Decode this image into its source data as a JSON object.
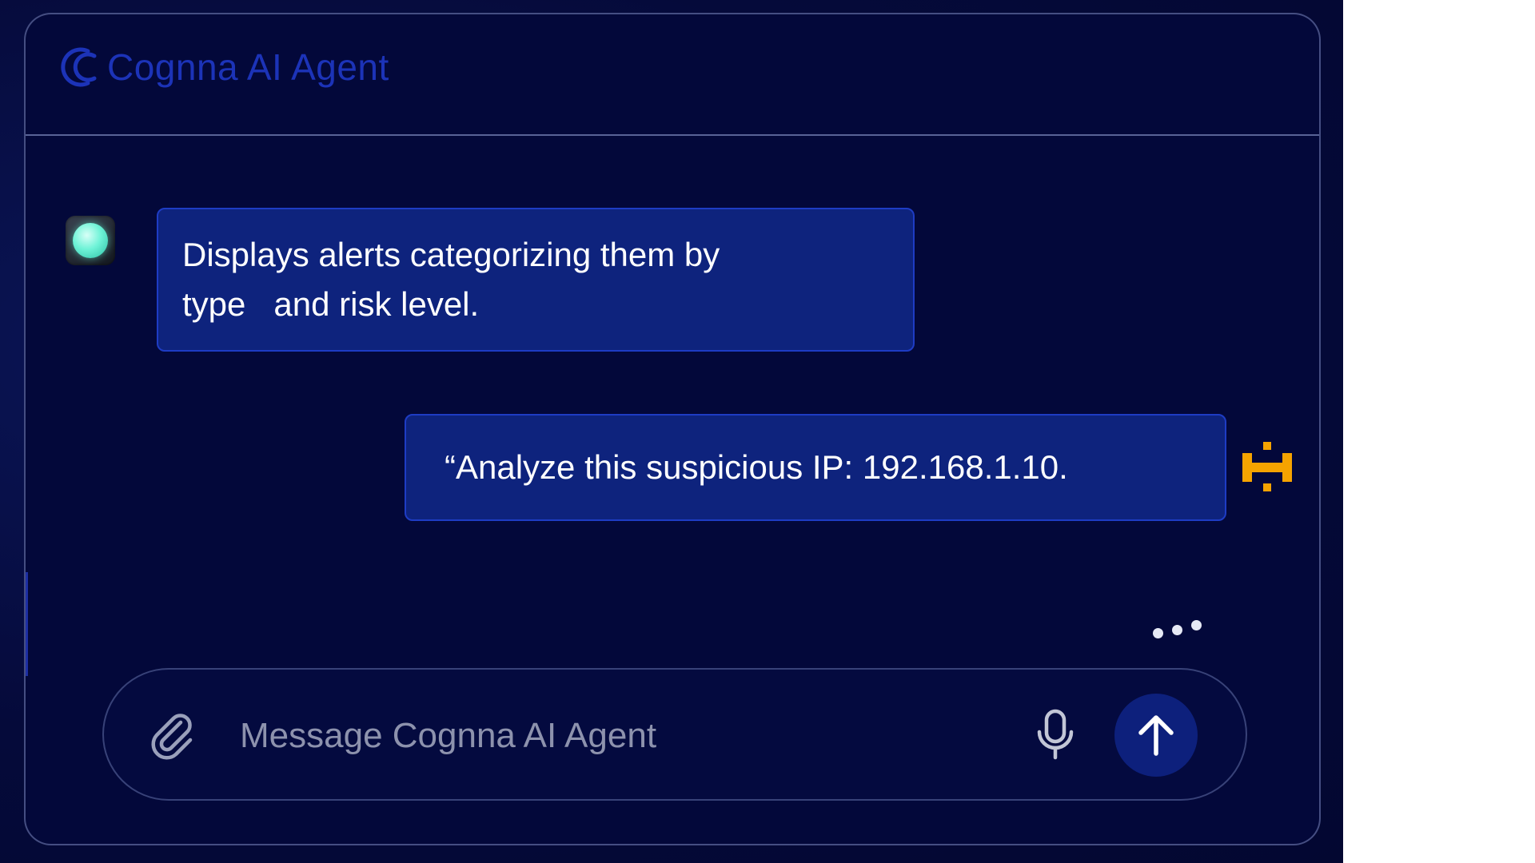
{
  "app": {
    "brand_name": "Cognna AI Agent",
    "brand_color": "#1c33b8",
    "logo_icon": "cognna-logo-icon"
  },
  "theme": {
    "panel_background": "#03083a",
    "bubble_background": "#0e237d",
    "bubble_border": "#1e3cc4",
    "user_avatar_color": "#f5a300",
    "bot_avatar_color": "#6ff3d7"
  },
  "conversation": {
    "messages": [
      {
        "role": "agent",
        "avatar_icon": "bot-orb-icon",
        "line1": "Displays alerts categorizing them by",
        "line2": "type   and risk level."
      },
      {
        "role": "user",
        "avatar_icon": "user-pixel-avatar-icon",
        "text": "“Analyze this suspicious IP: 192.168.1.10."
      }
    ],
    "typing_indicator": "typing-dots-icon"
  },
  "composer": {
    "placeholder": "Message Cognna AI Agent",
    "value": "",
    "attach_icon": "paperclip-icon",
    "mic_icon": "microphone-icon",
    "send_icon": "arrow-up-icon"
  }
}
